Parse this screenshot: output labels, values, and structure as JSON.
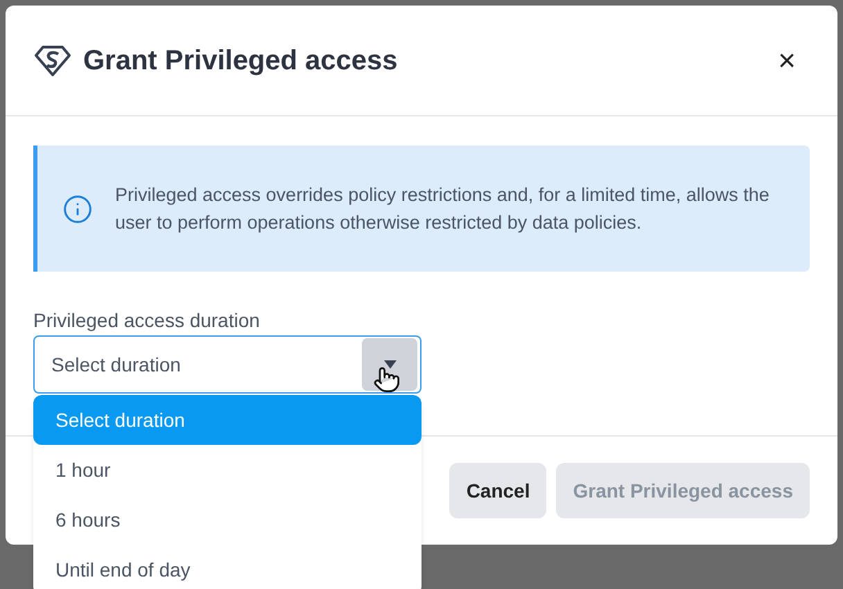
{
  "dialog": {
    "title": "Grant Privileged access",
    "close": "×"
  },
  "info": {
    "text": "Privileged access overrides policy restrictions and, for a limited time, allows the user to perform operations otherwise restricted by data policies."
  },
  "duration": {
    "label": "Privileged access duration",
    "value": "Select duration",
    "expanded": true,
    "options": [
      {
        "label": "Select duration",
        "selected": true
      },
      {
        "label": "1 hour",
        "selected": false
      },
      {
        "label": "6 hours",
        "selected": false
      },
      {
        "label": "Until end of day",
        "selected": false
      }
    ]
  },
  "buttons": [
    {
      "label": "Cancel",
      "disabled": false
    },
    {
      "label": "Grant Privileged access",
      "disabled": true
    }
  ]
}
